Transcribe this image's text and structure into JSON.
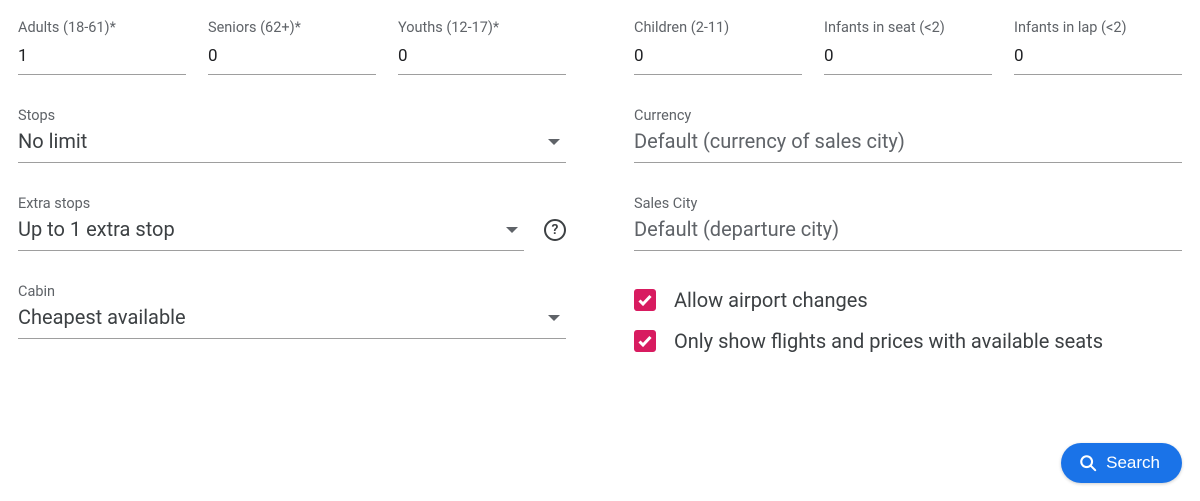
{
  "passengers": {
    "adults": {
      "label": "Adults (18-61)*",
      "value": "1"
    },
    "seniors": {
      "label": "Seniors (62+)*",
      "value": "0"
    },
    "youths": {
      "label": "Youths (12-17)*",
      "value": "0"
    },
    "children": {
      "label": "Children (2-11)",
      "value": "0"
    },
    "infants_seat": {
      "label": "Infants in seat (<2)",
      "value": "0"
    },
    "infants_lap": {
      "label": "Infants in lap (<2)",
      "value": "0"
    }
  },
  "stops": {
    "label": "Stops",
    "value": "No limit"
  },
  "extra_stops": {
    "label": "Extra stops",
    "value": "Up to 1 extra stop"
  },
  "cabin": {
    "label": "Cabin",
    "value": "Cheapest available"
  },
  "currency": {
    "label": "Currency",
    "placeholder": "Default (currency of sales city)"
  },
  "sales_city": {
    "label": "Sales City",
    "placeholder": "Default (departure city)"
  },
  "checkboxes": {
    "airport_changes": {
      "label": "Allow airport changes",
      "checked": true
    },
    "available_seats": {
      "label": "Only show flights and prices with available seats",
      "checked": true
    }
  },
  "search_button": "Search",
  "help_glyph": "?"
}
